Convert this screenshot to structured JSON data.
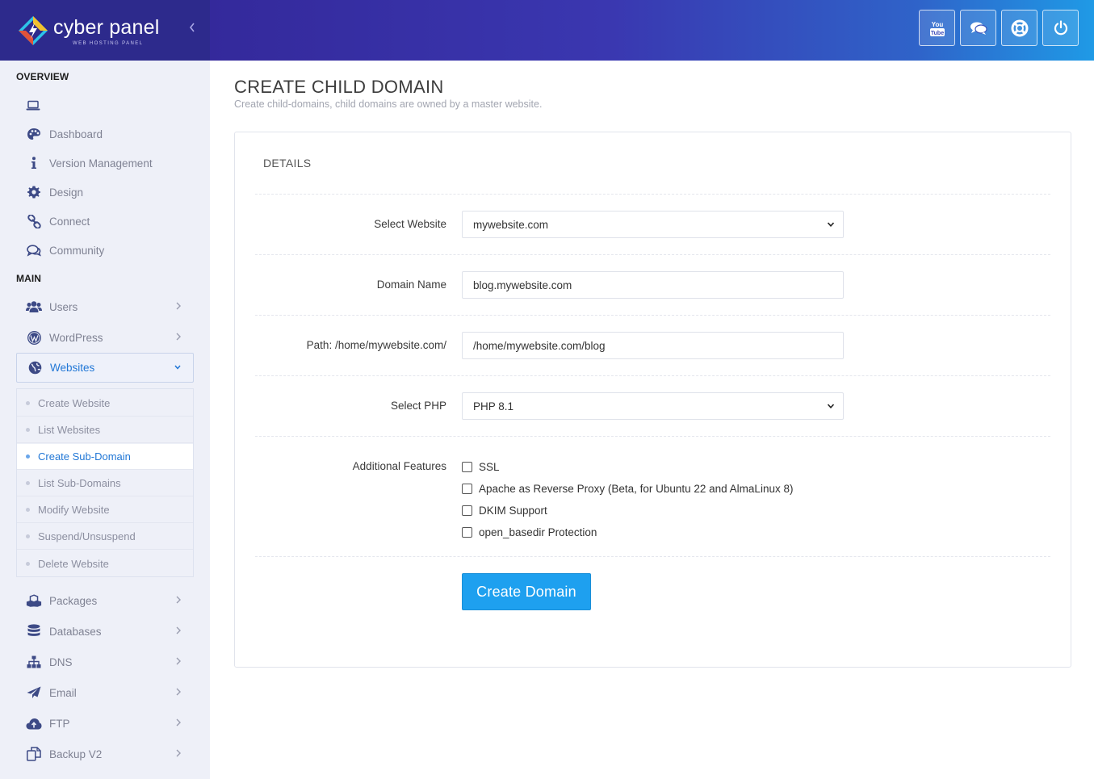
{
  "brand": {
    "name": "cyber panel",
    "tagline": "WEB HOSTING PANEL"
  },
  "topbar": {
    "buttons": [
      {
        "icon": "youtube-icon"
      },
      {
        "icon": "chat-icon"
      },
      {
        "icon": "lifebuoy-icon"
      },
      {
        "icon": "power-icon"
      }
    ]
  },
  "sidebar": {
    "overview_title": "OVERVIEW",
    "main_title": "MAIN",
    "overview_items": [
      {
        "label": "Dashboard",
        "icon": "palette-icon"
      },
      {
        "label": "Version Management",
        "icon": "info-icon"
      },
      {
        "label": "Design",
        "icon": "gear-icon"
      },
      {
        "label": "Connect",
        "icon": "link-icon"
      },
      {
        "label": "Community",
        "icon": "chat-bubbles-icon"
      }
    ],
    "main_items": [
      {
        "label": "Users",
        "icon": "users-icon"
      },
      {
        "label": "WordPress",
        "icon": "wordpress-icon"
      },
      {
        "label": "Websites",
        "icon": "globe-icon"
      },
      {
        "label": "Packages",
        "icon": "cubes-icon"
      },
      {
        "label": "Databases",
        "icon": "database-icon"
      },
      {
        "label": "DNS",
        "icon": "sitemap-icon"
      },
      {
        "label": "Email",
        "icon": "paper-plane-icon"
      },
      {
        "label": "FTP",
        "icon": "cloud-upload-icon"
      },
      {
        "label": "Backup V2",
        "icon": "copy-icon"
      }
    ],
    "websites_submenu": [
      "Create Website",
      "List Websites",
      "Create Sub-Domain",
      "List Sub-Domains",
      "Modify Website",
      "Suspend/Unsuspend",
      "Delete Website"
    ],
    "active_submenu": "Create Sub-Domain"
  },
  "page": {
    "title": "CREATE CHILD DOMAIN",
    "subtitle": "Create child-domains, child domains are owned by a master website.",
    "card_title": "DETAILS"
  },
  "form": {
    "select_website_label": "Select Website",
    "select_website_value": "mywebsite.com",
    "domain_name_label": "Domain Name",
    "domain_name_value": "blog.mywebsite.com",
    "path_label": "Path: /home/mywebsite.com/",
    "path_value": "/home/mywebsite.com/blog",
    "select_php_label": "Select PHP",
    "select_php_value": "PHP 8.1",
    "features_label": "Additional Features",
    "features": [
      "SSL",
      "Apache as Reverse Proxy (Beta, for Ubuntu 22 and AlmaLinux 8)",
      "DKIM Support",
      "open_basedir Protection"
    ],
    "submit_label": "Create Domain"
  },
  "colors": {
    "accent": "#2177d6",
    "button": "#1ea0ef",
    "header": "#2d2a8c"
  }
}
